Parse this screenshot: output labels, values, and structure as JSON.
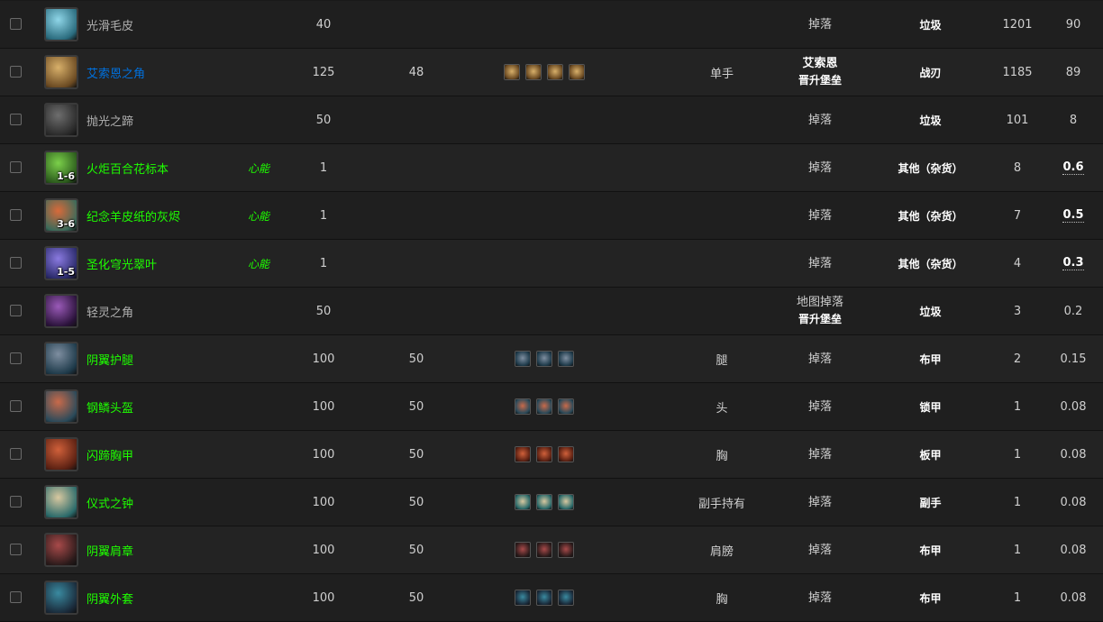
{
  "rows": [
    {
      "name": "光滑毛皮",
      "quality": "gray",
      "tag": "",
      "qty": "",
      "level": "40",
      "req": "",
      "sockets": 0,
      "slot": "",
      "source": "掉落",
      "zone": "",
      "type": "垃圾",
      "n1": "1201",
      "n2": "90",
      "n2bold": false,
      "icon": "fur-icon",
      "ic": [
        "#8fd6e8",
        "#2a6b7d"
      ]
    },
    {
      "name": "艾索恩之角",
      "quality": "blue",
      "tag": "",
      "qty": "",
      "level": "125",
      "req": "48",
      "sockets": 4,
      "slot": "单手",
      "source": "艾索恩",
      "zone": "晋升堡垒",
      "type": "战刃",
      "n1": "1185",
      "n2": "89",
      "n2bold": false,
      "icon": "glaive-icon",
      "ic": [
        "#d8b06a",
        "#6b4a22"
      ]
    },
    {
      "name": "抛光之蹄",
      "quality": "gray",
      "tag": "",
      "qty": "",
      "level": "50",
      "req": "",
      "sockets": 0,
      "slot": "",
      "source": "掉落",
      "zone": "",
      "type": "垃圾",
      "n1": "101",
      "n2": "8",
      "n2bold": false,
      "icon": "hoof-icon",
      "ic": [
        "#6e6e6e",
        "#2a2a2a"
      ]
    },
    {
      "name": "火炬百合花标本",
      "quality": "green",
      "tag": "心能",
      "qty": "1-6",
      "level": "1",
      "req": "",
      "sockets": 0,
      "slot": "",
      "source": "掉落",
      "zone": "",
      "type": "其他（杂货）",
      "n1": "8",
      "n2": "0.6",
      "n2bold": true,
      "icon": "lily-icon",
      "ic": [
        "#7bd04a",
        "#2b5a1c"
      ]
    },
    {
      "name": "纪念羊皮纸的灰烬",
      "quality": "green",
      "tag": "心能",
      "qty": "3-6",
      "level": "1",
      "req": "",
      "sockets": 0,
      "slot": "",
      "source": "掉落",
      "zone": "",
      "type": "其他（杂货）",
      "n1": "7",
      "n2": "0.5",
      "n2bold": true,
      "icon": "ashes-icon",
      "ic": [
        "#d86a3a",
        "#3a6a5a"
      ]
    },
    {
      "name": "圣化穹光翠叶",
      "quality": "green",
      "tag": "心能",
      "qty": "1-5",
      "level": "1",
      "req": "",
      "sockets": 0,
      "slot": "",
      "source": "掉落",
      "zone": "",
      "type": "其他（杂货）",
      "n1": "4",
      "n2": "0.3",
      "n2bold": true,
      "icon": "leaf-icon",
      "ic": [
        "#8a7ae0",
        "#2a2a6a"
      ]
    },
    {
      "name": "轻灵之角",
      "quality": "gray",
      "tag": "",
      "qty": "",
      "level": "50",
      "req": "",
      "sockets": 0,
      "slot": "",
      "source": "地图掉落",
      "zone": "晋升堡垒",
      "type": "垃圾",
      "n1": "3",
      "n2": "0.2",
      "n2bold": false,
      "icon": "horn-icon",
      "ic": [
        "#9a5ab8",
        "#2a123a"
      ]
    },
    {
      "name": "阴翼护腿",
      "quality": "green",
      "tag": "",
      "qty": "",
      "level": "100",
      "req": "50",
      "sockets": 3,
      "slot": "腿",
      "source": "掉落",
      "zone": "",
      "type": "布甲",
      "n1": "2",
      "n2": "0.15",
      "n2bold": false,
      "icon": "leggings-icon",
      "ic": [
        "#7e8ea0",
        "#1e3a4a"
      ]
    },
    {
      "name": "钢鳞头盔",
      "quality": "green",
      "tag": "",
      "qty": "",
      "level": "100",
      "req": "50",
      "sockets": 3,
      "slot": "头",
      "source": "掉落",
      "zone": "",
      "type": "锁甲",
      "n1": "1",
      "n2": "0.08",
      "n2bold": false,
      "icon": "helm-icon",
      "ic": [
        "#c86a4a",
        "#2a4a5a"
      ]
    },
    {
      "name": "闪蹄胸甲",
      "quality": "green",
      "tag": "",
      "qty": "",
      "level": "100",
      "req": "50",
      "sockets": 3,
      "slot": "胸",
      "source": "掉落",
      "zone": "",
      "type": "板甲",
      "n1": "1",
      "n2": "0.08",
      "n2bold": false,
      "icon": "breastplate-icon",
      "ic": [
        "#d0603a",
        "#5a2012"
      ]
    },
    {
      "name": "仪式之钟",
      "quality": "green",
      "tag": "",
      "qty": "",
      "level": "100",
      "req": "50",
      "sockets": 3,
      "slot": "副手持有",
      "source": "掉落",
      "zone": "",
      "type": "副手",
      "n1": "1",
      "n2": "0.08",
      "n2bold": false,
      "icon": "bell-icon",
      "ic": [
        "#d8c8a0",
        "#2a6a6a"
      ]
    },
    {
      "name": "阴翼肩章",
      "quality": "green",
      "tag": "",
      "qty": "",
      "level": "100",
      "req": "50",
      "sockets": 3,
      "slot": "肩膀",
      "source": "掉落",
      "zone": "",
      "type": "布甲",
      "n1": "1",
      "n2": "0.08",
      "n2bold": false,
      "icon": "shoulders-icon",
      "ic": [
        "#a84a4a",
        "#2a1a1a"
      ]
    },
    {
      "name": "阴翼外套",
      "quality": "green",
      "tag": "",
      "qty": "",
      "level": "100",
      "req": "50",
      "sockets": 3,
      "slot": "胸",
      "source": "掉落",
      "zone": "",
      "type": "布甲",
      "n1": "1",
      "n2": "0.08",
      "n2bold": false,
      "icon": "robe-icon",
      "ic": [
        "#3a8aa0",
        "#1a2a3a"
      ]
    }
  ]
}
